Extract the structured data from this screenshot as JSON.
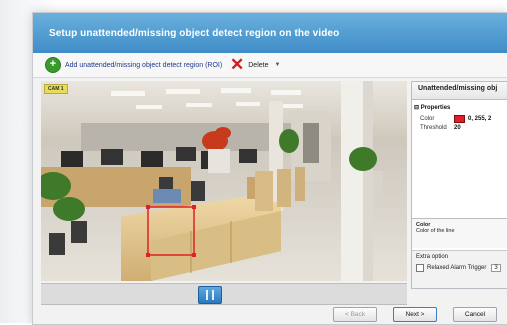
{
  "window": {
    "title": "Setup unattended/missing object detect region on the video"
  },
  "toolbar": {
    "add_label": "Add unattended/missing object detect region (ROI)",
    "delete_label": "Delete"
  },
  "video": {
    "camera_label": "CAM 1"
  },
  "slider": {
    "position": 0.46
  },
  "panel": {
    "header": "Unattended/missing obj",
    "properties_title": "Properties",
    "rows": [
      {
        "key": "Color",
        "value": "0, 255, 2",
        "swatch": "#e01f26"
      },
      {
        "key": "Threshold",
        "value": "20"
      }
    ],
    "description_title": "Color",
    "description_text": "Color of the line",
    "options_title": "Extra option",
    "trigger_label": "Relaxed Alarm Trigger",
    "trigger_value": "3"
  },
  "footer": {
    "back_label": "< Back",
    "next_label": "Next >",
    "cancel_label": "Cancel"
  },
  "colors": {
    "titlebar": "#3f8cc7",
    "roi": "#e01f26",
    "slider": "#2a78be"
  }
}
